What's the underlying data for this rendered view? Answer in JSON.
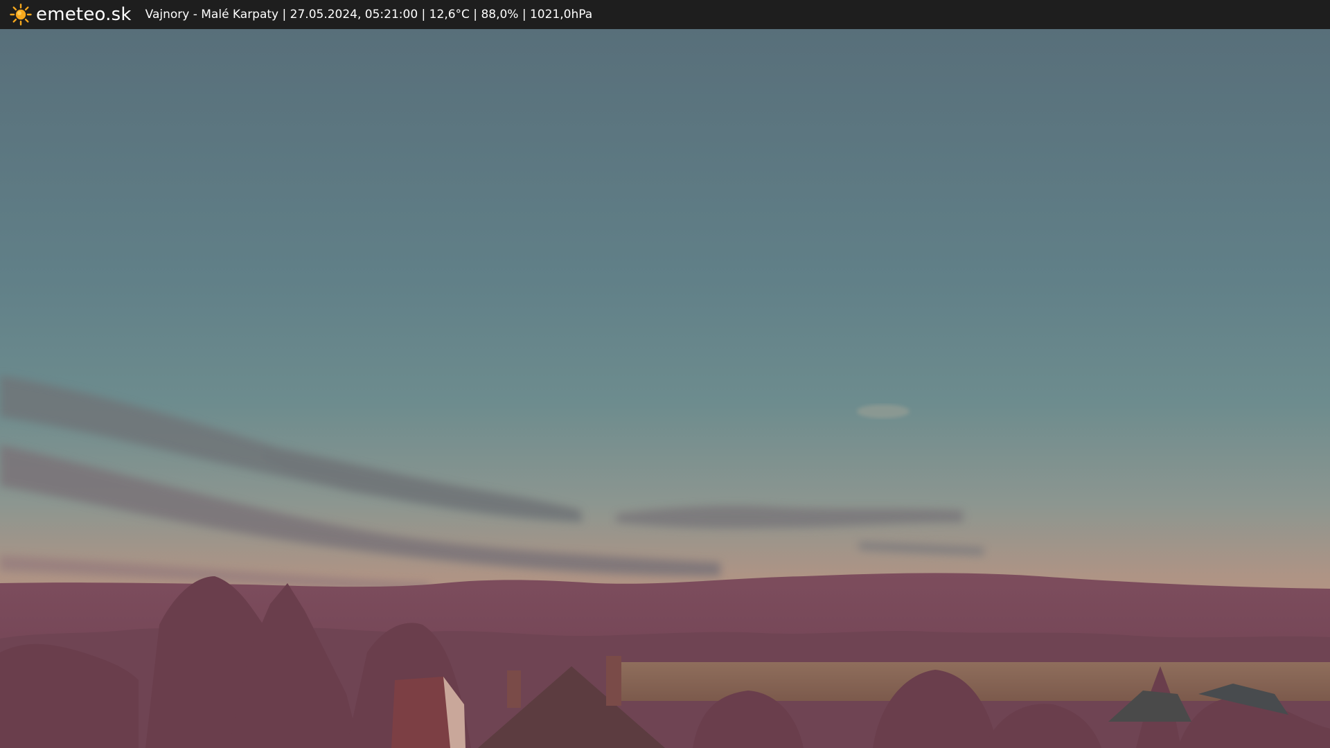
{
  "header": {
    "brand": "emeteo.sk",
    "logo_icon": "sun-icon",
    "info": "Vajnory - Malé Karpaty | 27.05.2024, 05:21:00 | 12,6°C | 88,0% | 1021,0hPa"
  },
  "colors": {
    "bar_background": "#1e1e1e",
    "sun": "#f7a81d",
    "sky_top": "#586f7a",
    "sky_mid": "#6a8a8d",
    "sky_horizon": "#b49280",
    "hills": "#7e4e5d",
    "trees": "#764a58",
    "field": "#8e6b58"
  }
}
